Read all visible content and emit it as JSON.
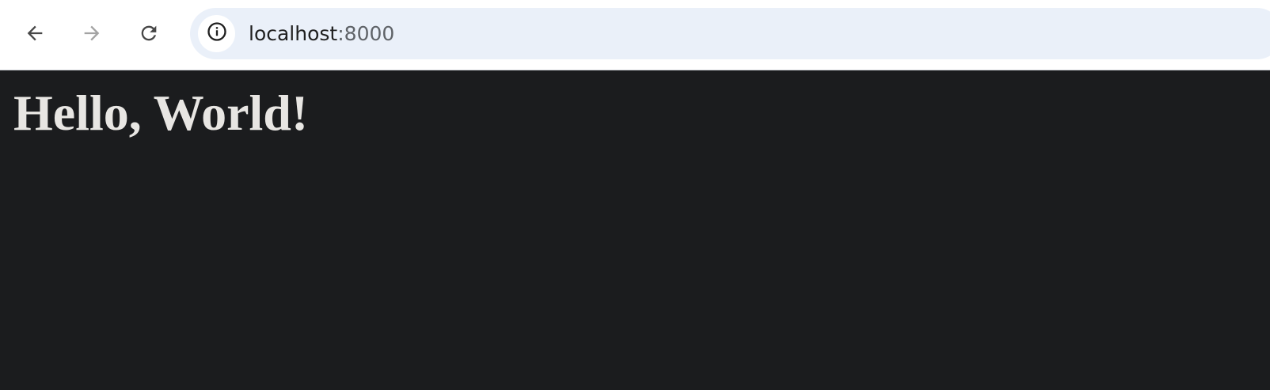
{
  "browser": {
    "nav": {
      "back_icon": "arrow-left-icon",
      "forward_icon": "arrow-right-icon",
      "reload_icon": "reload-icon",
      "forward_enabled": false
    },
    "address_bar": {
      "info_icon": "info-icon",
      "url_host": "localhost",
      "url_port": ":8000"
    },
    "colors": {
      "toolbar_bg": "#ffffff",
      "address_bar_bg": "#eaf0f9",
      "icon_active": "#474747",
      "icon_disabled": "#a3a3a3"
    }
  },
  "page": {
    "heading": "Hello, World!",
    "colors": {
      "background": "#1b1c1e",
      "text": "#e8e6e3"
    }
  }
}
